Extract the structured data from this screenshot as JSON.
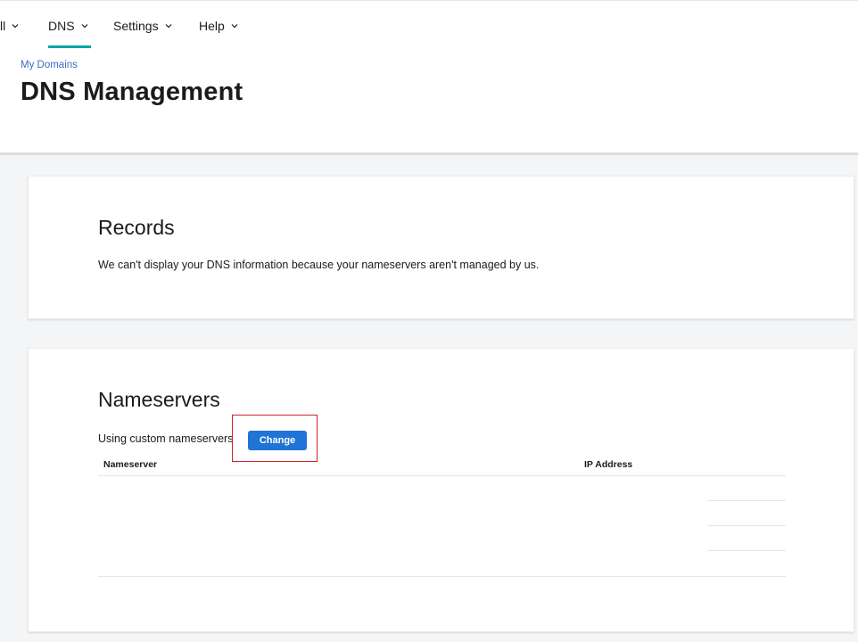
{
  "nav": {
    "items": [
      {
        "label": "ll"
      },
      {
        "label": "DNS"
      },
      {
        "label": "Settings"
      },
      {
        "label": "Help"
      }
    ],
    "active": "DNS",
    "accent_color": "#00a4a6"
  },
  "header": {
    "breadcrumb": "My Domains",
    "title": "DNS Management"
  },
  "records": {
    "title": "Records",
    "message": "We can't display your DNS information because your nameservers aren't managed by us."
  },
  "nameservers": {
    "title": "Nameservers",
    "status_text": "Using custom nameservers",
    "change_label": "Change",
    "button_color": "#1f74d6",
    "columns": [
      "Nameserver",
      "IP Address"
    ],
    "rows": []
  },
  "icons": {
    "dropdown": "chevron-down-icon"
  }
}
